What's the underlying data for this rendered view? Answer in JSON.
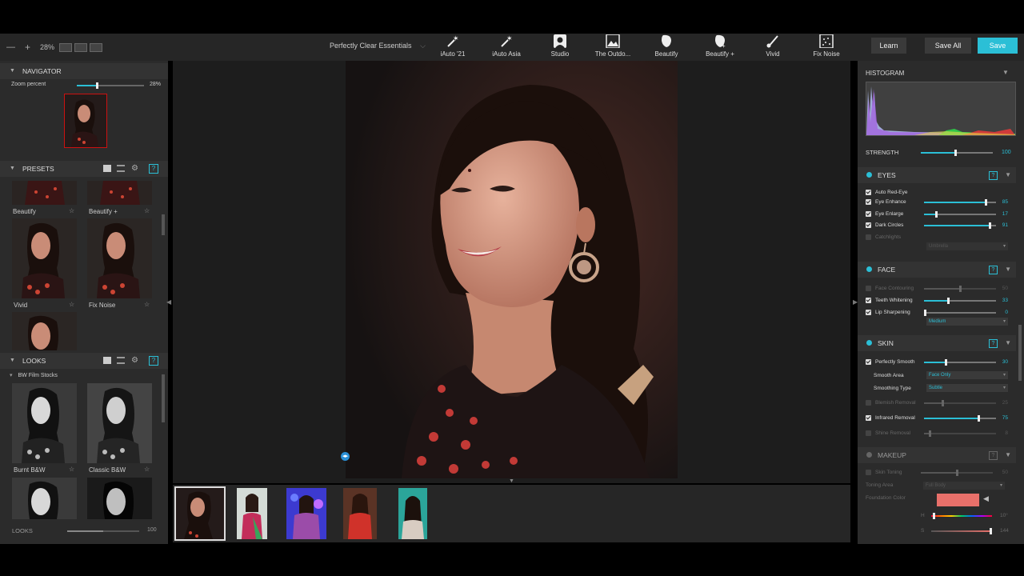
{
  "topbar": {
    "zoom": "28%",
    "preset_selector": "Perfectly Clear Essentials",
    "tools": [
      {
        "label": "iAuto '21",
        "icon": "magic-wand-icon"
      },
      {
        "label": "iAuto Asia",
        "icon": "magic-wand-icon"
      },
      {
        "label": "Studio",
        "icon": "portrait-icon"
      },
      {
        "label": "The Outdo...",
        "icon": "landscape-icon"
      },
      {
        "label": "Beautify",
        "icon": "face-icon"
      },
      {
        "label": "Beautify +",
        "icon": "face-plus-icon"
      },
      {
        "label": "Vivid",
        "icon": "brush-icon"
      },
      {
        "label": "Fix Noise",
        "icon": "noise-icon"
      }
    ],
    "learn": "Learn",
    "save_all": "Save All",
    "save": "Save"
  },
  "navigator": {
    "title": "NAVIGATOR",
    "zoom_label": "Zoom percent",
    "zoom_value": "28%",
    "zoom_fraction": 0.28
  },
  "presets": {
    "title": "PRESETS",
    "items": [
      {
        "label": "Beautify"
      },
      {
        "label": "Beautify +"
      },
      {
        "label": "Vivid"
      },
      {
        "label": "Fix Noise"
      }
    ]
  },
  "looks": {
    "title": "LOOKS",
    "group": "BW Film Stocks",
    "items": [
      {
        "label": "Burnt B&W"
      },
      {
        "label": "Classic B&W"
      }
    ],
    "footer_label": "LOOKS",
    "footer_value": "100",
    "footer_fraction": 0.5
  },
  "right": {
    "histogram": {
      "title": "HISTOGRAM"
    },
    "strength": {
      "label": "STRENGTH",
      "value": "100"
    },
    "eyes": {
      "title": "EYES",
      "rows": [
        {
          "label": "Auto Red-Eye",
          "checked": true
        },
        {
          "label": "Eye Enhance",
          "value": "85",
          "level": 0.85,
          "checked": true
        },
        {
          "label": "Eye Enlarge",
          "value": "17",
          "level": 0.17,
          "checked": true
        },
        {
          "label": "Dark Circles",
          "value": "91",
          "level": 0.91,
          "checked": true
        },
        {
          "label": "Catchlights",
          "checked": false
        }
      ],
      "catchlight_option": "Umbrella"
    },
    "face": {
      "title": "FACE",
      "rows": [
        {
          "label": "Face Contouring",
          "value": "50",
          "level": 0.5,
          "checked": false
        },
        {
          "label": "Teeth Whitening",
          "value": "33",
          "level": 0.33,
          "checked": true
        },
        {
          "label": "Lip Sharpening",
          "value": "0",
          "level": 0.0,
          "checked": true
        }
      ],
      "lip_option": "Medium"
    },
    "skin": {
      "title": "SKIN",
      "smooth": {
        "label": "Perfectly Smooth",
        "value": "30",
        "level": 0.3
      },
      "smooth_area_label": "Smooth Area",
      "smooth_area_value": "Face Only",
      "smoothing_type_label": "Smoothing Type",
      "smoothing_type_value": "Subtle",
      "blemish": {
        "label": "Blemish Removal",
        "value": "25",
        "level": 0.25
      },
      "infrared": {
        "label": "Infrared Removal",
        "value": "75",
        "level": 0.75
      },
      "shine": {
        "label": "Shine Removal",
        "value": "8",
        "level": 0.08
      }
    },
    "makeup": {
      "title": "MAKEUP",
      "skin_toning_label": "Skin Toning",
      "skin_toning_value": "50",
      "toning_area_label": "Toning Area",
      "toning_area_value": "Full Body",
      "foundation_label": "Foundation Color",
      "foundation_color": "#e8706a",
      "h_label": "H",
      "h_value": "10°",
      "s_label": "S",
      "s_value": "144"
    }
  },
  "colors": {
    "accent": "#2bbfd6"
  }
}
